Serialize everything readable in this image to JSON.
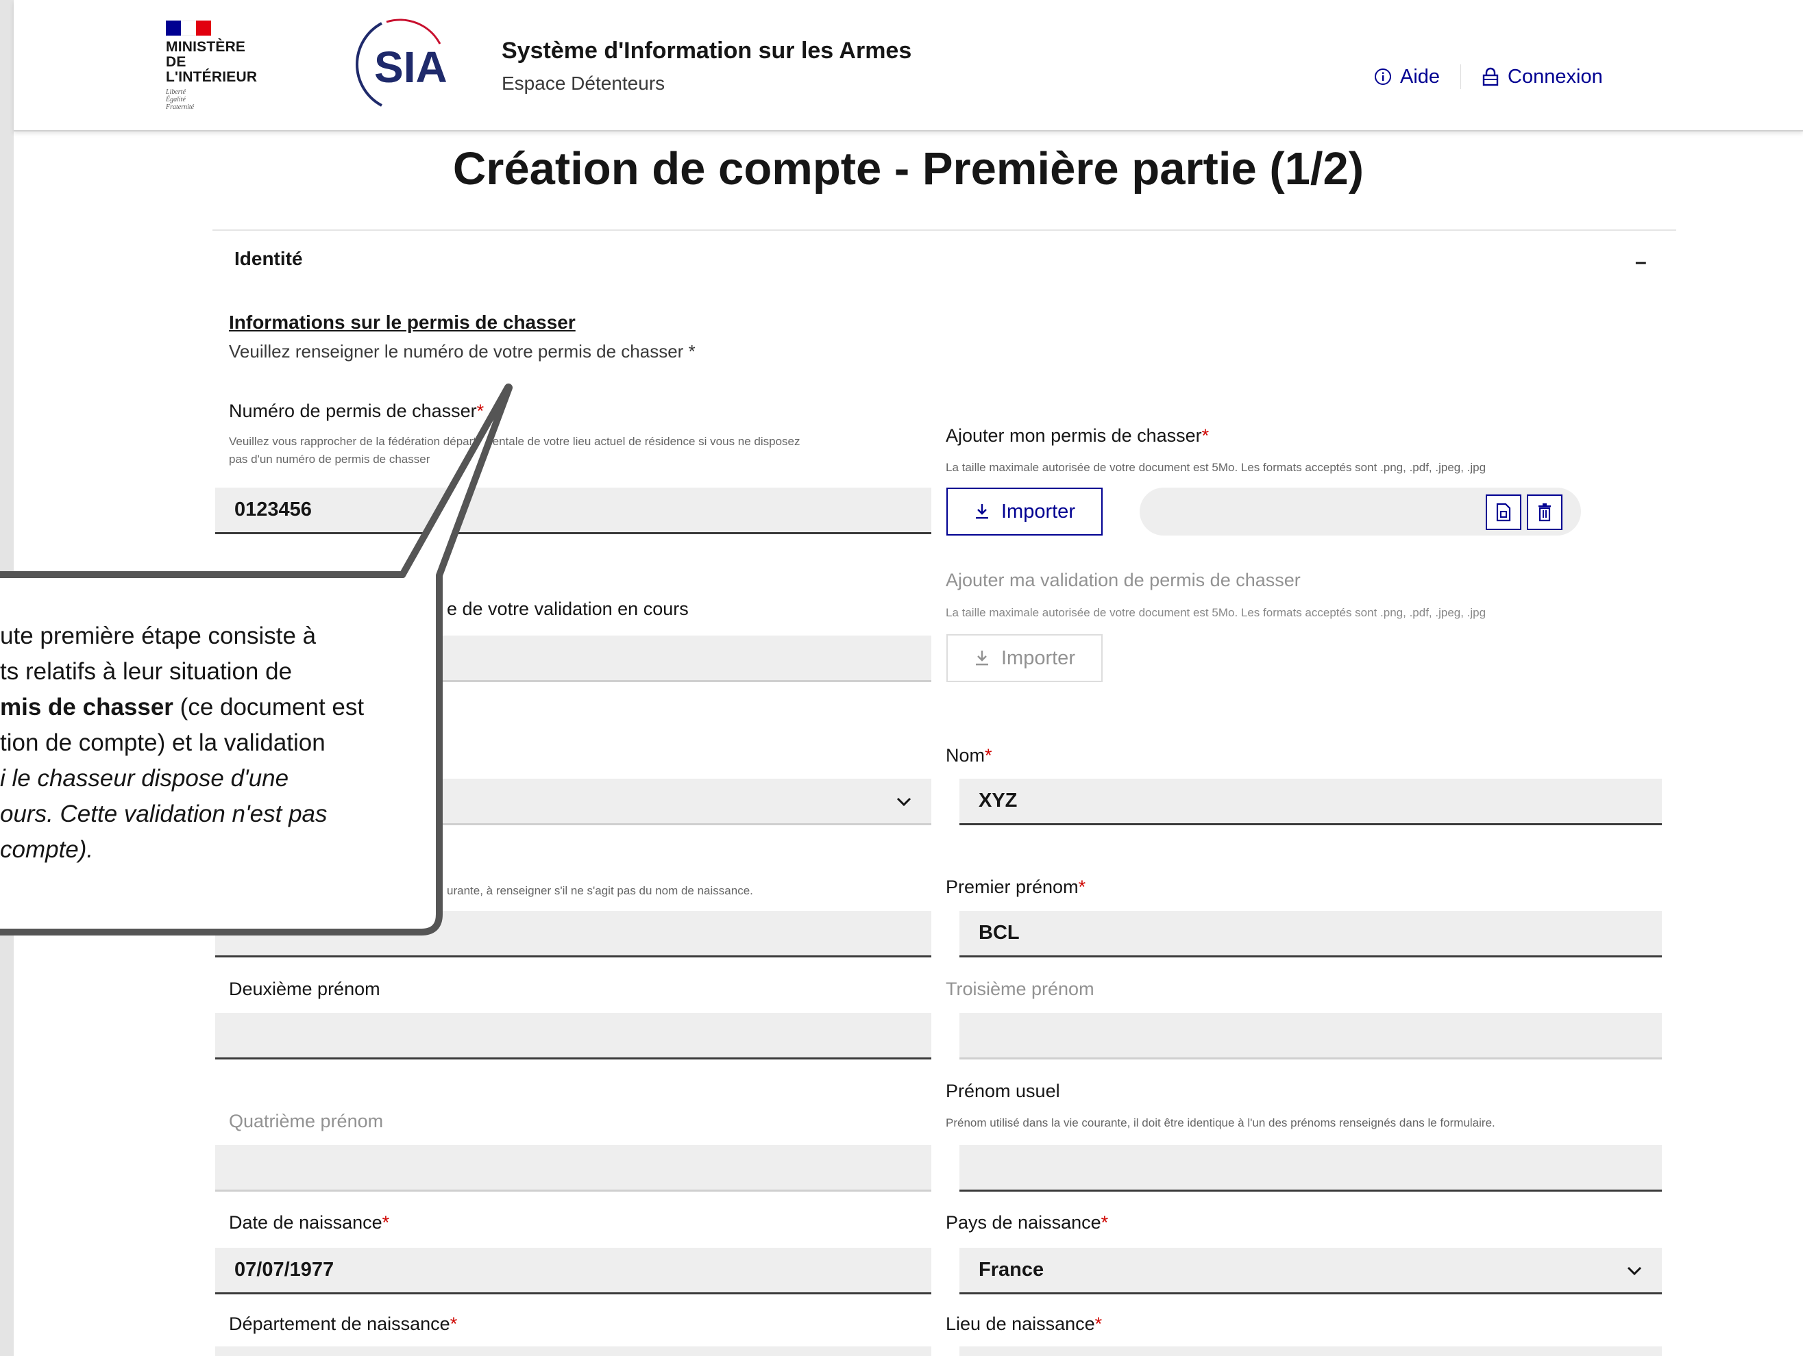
{
  "header": {
    "ministry_line1": "MINISTÈRE",
    "ministry_line2": "DE L'INTÉRIEUR",
    "motto": [
      "Liberté",
      "Égalité",
      "Fraternité"
    ],
    "sia_logo_text": "SIA",
    "site_title": "Système d'Information sur les Armes",
    "site_subtitle": "Espace Détenteurs",
    "links": {
      "aide": "Aide",
      "connexion": "Connexion"
    }
  },
  "page": {
    "title": "Création de compte - Première partie (1/2)",
    "section": "Identité",
    "collapse_symbol": "–",
    "info_title": "Informations sur le permis de chasser",
    "info_subtitle": "Veuillez renseigner le numéro de votre permis de chasser *"
  },
  "form": {
    "permit_number": {
      "label": "Numéro de permis de chasser",
      "required_mark": "*",
      "hint_line1": "Veuillez vous rapprocher de la fédération départementale de votre lieu actuel de résidence si vous ne disposez",
      "hint_line2": "pas d'un numéro de permis de chasser",
      "value": "0123456"
    },
    "add_permit": {
      "label": "Ajouter mon permis de chasser",
      "required_mark": "*",
      "hint": "La taille maximale autorisée de votre document est 5Mo. Les formats acceptés sont .png, .pdf, .jpeg, .jpg",
      "button": "Importer"
    },
    "validation_in_progress": {
      "label_visible_part": "e de votre validation en cours"
    },
    "add_validation": {
      "label": "Ajouter ma validation de permis de chasser",
      "hint": "La taille maximale autorisée de votre document est 5Mo. Les formats acceptés sont .png, .pdf, .jpeg, .jpg",
      "button": "Importer"
    },
    "nom": {
      "label": "Nom",
      "required_mark": "*",
      "value": "XYZ"
    },
    "nom_usage_hint_visible_part": "urante, à renseigner s'il ne s'agit pas du nom de naissance.",
    "premier_prenom": {
      "label": "Premier prénom",
      "required_mark": "*",
      "value": "BCL"
    },
    "deuxieme_prenom": {
      "label": "Deuxième prénom",
      "value": ""
    },
    "troisieme_prenom": {
      "label": "Troisième prénom",
      "value": ""
    },
    "quatrieme_prenom": {
      "label": "Quatrième prénom",
      "value": ""
    },
    "prenom_usuel": {
      "label": "Prénom usuel",
      "hint": "Prénom utilisé dans la vie courante, il doit être identique à l'un des prénoms renseignés dans le formulaire.",
      "value": ""
    },
    "date_naissance": {
      "label": "Date de naissance",
      "required_mark": "*",
      "value": "07/07/1977"
    },
    "pays_naissance": {
      "label": "Pays de naissance",
      "required_mark": "*",
      "value": "France"
    },
    "departement_naissance": {
      "label": "Département de naissance",
      "required_mark": "*"
    },
    "lieu_naissance": {
      "label": "Lieu de naissance",
      "required_mark": "*"
    }
  },
  "callout": {
    "line1": "ute première étape consiste à",
    "line2": "ts relatifs à leur situation de",
    "line3_bold": "mis de chasser",
    "line3_rest": " (ce document est",
    "line4": "tion de compte) et la validation",
    "line5": "i le chasseur dispose d'une",
    "line6": "ours. Cette validation n'est pas",
    "line7": " compte)."
  },
  "colors": {
    "primary_blue": "#000091",
    "required_red": "#ce0500",
    "field_bg": "#eeeeee",
    "flag_blue": "#000091",
    "flag_white": "#ffffff",
    "flag_red": "#e1000f",
    "logo_outline": "#1f2a6b",
    "logo_accent": "#c8102e"
  },
  "icons": {
    "aide": "info-circle-icon",
    "connexion": "lock-icon",
    "import": "download-icon",
    "file_preview": "file-icon",
    "delete": "trash-icon",
    "select": "chevron-down-icon"
  }
}
